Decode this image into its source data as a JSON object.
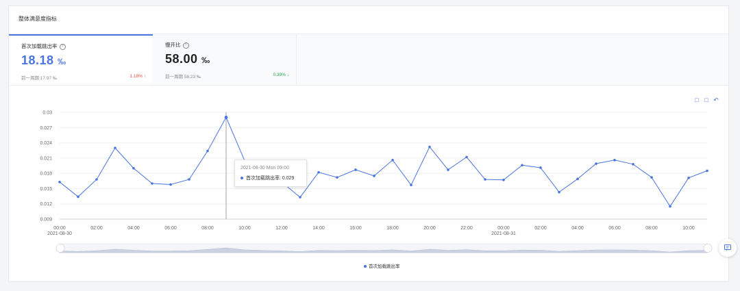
{
  "card": {
    "title": "整体满意度指标"
  },
  "metrics": [
    {
      "name": "首次加载跳出率",
      "value": "18.18",
      "unit": "‰",
      "prev_label": "前一周期 17.97 ‰",
      "change": "1.18%",
      "direction": "up",
      "value_color": "#4a74e0",
      "change_color": "#e8473c"
    },
    {
      "name": "慢开比",
      "value": "58.00",
      "unit": "‰",
      "prev_label": "前一周期 58.23 ‰",
      "change": "0.39%",
      "direction": "down",
      "value_color": "#222222",
      "change_color": "#2aa34a"
    }
  ],
  "toolbar": {
    "icons": [
      "zoom-select-icon",
      "zoom-reset-icon",
      "restore-icon"
    ]
  },
  "tooltip": {
    "title": "2021-08-30 Mon 09:00",
    "label": "首次加载跳出率:",
    "value": "0.029"
  },
  "colors": {
    "series": "#4a74e0",
    "grid": "#eef0f3",
    "axis": "#d0d3d8"
  },
  "chart_data": {
    "type": "line",
    "series": [
      {
        "name": "首次加载跳出率",
        "values": [
          0.0163,
          0.0134,
          0.0168,
          0.023,
          0.019,
          0.016,
          0.0158,
          0.0168,
          0.0224,
          0.029,
          0.0205,
          0.018,
          0.0163,
          0.0133,
          0.0182,
          0.0172,
          0.0187,
          0.0175,
          0.0206,
          0.0157,
          0.0232,
          0.0187,
          0.0212,
          0.0168,
          0.0167,
          0.0196,
          0.0191,
          0.0143,
          0.0169,
          0.0199,
          0.0206,
          0.0198,
          0.0172,
          0.0115,
          0.0171,
          0.0185
        ]
      }
    ],
    "x_start": "2021-08-30 00:00",
    "x_step_hours": 1,
    "x_ticks": [
      "00:00",
      "02:00",
      "04:00",
      "06:00",
      "08:00",
      "10:00",
      "12:00",
      "14:00",
      "16:00",
      "18:00",
      "20:00",
      "22:00",
      "00:00",
      "02:00",
      "04:00",
      "06:00",
      "08:00",
      "10:00"
    ],
    "x_date_labels": [
      {
        "index": 0,
        "text": "2021-08-30"
      },
      {
        "index": 24,
        "text": "2021-08-31"
      }
    ],
    "y_ticks": [
      "0.009",
      "0.012",
      "0.015",
      "0.018",
      "0.021",
      "0.024",
      "0.027",
      "0.03"
    ],
    "ylim": [
      0.009,
      0.03
    ],
    "grid": true,
    "legend": "bottom-center",
    "highlight_index": 9
  }
}
